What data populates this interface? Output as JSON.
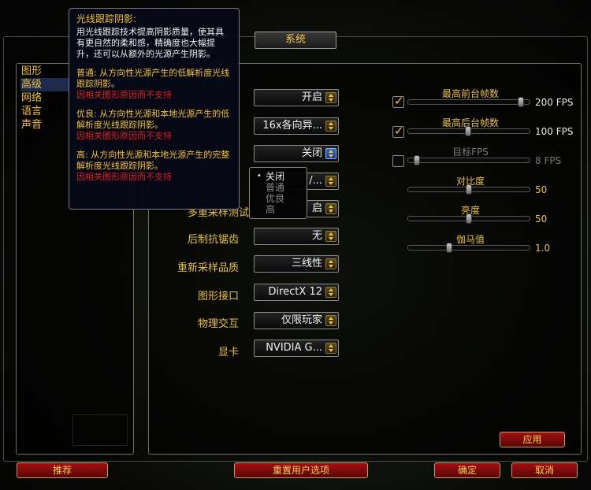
{
  "dialog": {
    "title": "系统"
  },
  "categories": [
    {
      "label": "图形",
      "active": false
    },
    {
      "label": "高级",
      "active": true
    },
    {
      "label": "网络",
      "active": false
    },
    {
      "label": "语言",
      "active": false
    },
    {
      "label": "声音",
      "active": false
    }
  ],
  "settings": {
    "row1": {
      "value": "开启"
    },
    "row2": {
      "value": "16x各向异..."
    },
    "row3": {
      "value": "关闭"
    },
    "row4": {
      "value": "/..."
    },
    "row5": {
      "label": "多重采样测试",
      "value": "启"
    },
    "post_aa": {
      "label": "后制抗锯齿",
      "value": "无"
    },
    "resample": {
      "label": "重新采样品质",
      "value": "三线性"
    },
    "graphics_api": {
      "label": "图形接口",
      "value": "DirectX 12"
    },
    "physics": {
      "label": "物理交互",
      "value": "仅限玩家"
    },
    "gpu": {
      "label": "显卡",
      "value": "NVIDIA G..."
    }
  },
  "popup_options": [
    {
      "label": "关闭",
      "selected": true
    },
    {
      "label": "普通",
      "selected": false
    },
    {
      "label": "优良",
      "selected": false
    },
    {
      "label": "高",
      "selected": false
    }
  ],
  "sliders": {
    "max_fg_fps": {
      "label": "最高前台帧数",
      "value": "200 FPS",
      "checked": true,
      "fraction": 0.95
    },
    "max_bg_fps": {
      "label": "最高后台帧数",
      "value": "100 FPS",
      "checked": true,
      "fraction": 0.49
    },
    "target_fps": {
      "label": "目标FPS",
      "value": "8 FPS",
      "checked": false,
      "fraction": 0.05
    },
    "contrast": {
      "label": "对比度",
      "value": "50",
      "fraction": 0.5
    },
    "brightness": {
      "label": "亮度",
      "value": "50",
      "fraction": 0.5
    },
    "gamma": {
      "label": "伽马值",
      "value": "1.0",
      "fraction": 0.33
    }
  },
  "tooltip": {
    "title": "光线跟踪阴影:",
    "desc": "用光线跟踪技术提高阴影质量，使其具有更自然的柔和感，精确度也大幅提升，还可以从额外的光源产生阴影。",
    "normal": "普通: 从方向性光源产生的低解析度光线跟踪阴影。",
    "normal_warn": "因相关图形原因而不支持",
    "good": "优良: 从方向性光源和本地光源产生的低解析度光线跟踪阴影。",
    "good_warn": "因相关图形原因而不支持",
    "high": "高: 从方向性光源和本地光源产生的完整解析度光线跟踪阴影。",
    "high_warn": "因相关图形原因而不支持"
  },
  "buttons": {
    "apply": "应用",
    "recommended": "推荐",
    "reset": "重置用户选项",
    "ok": "确定",
    "cancel": "取消"
  },
  "colors": {
    "gold": "#f0c040",
    "red_button": "#8a0a0a",
    "warning": "#e02020"
  }
}
